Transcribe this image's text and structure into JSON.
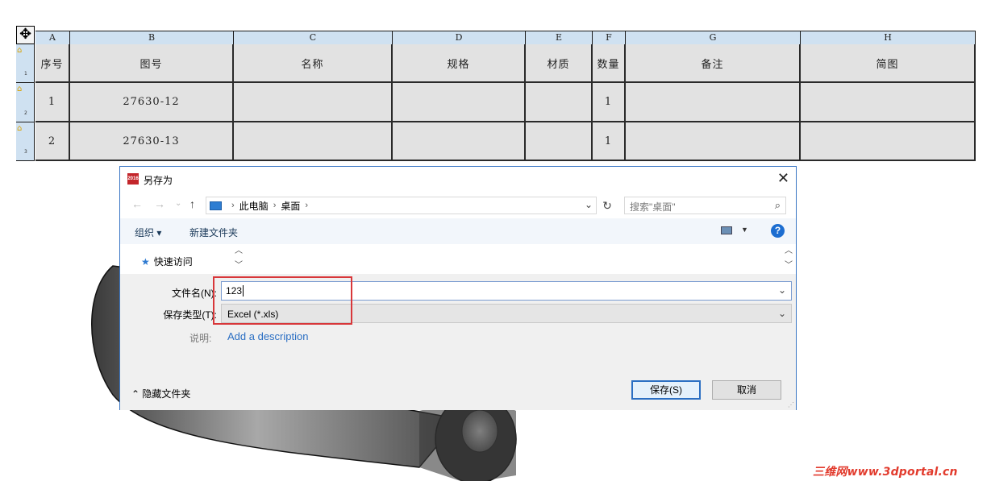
{
  "table": {
    "columns": [
      "A",
      "B",
      "C",
      "D",
      "E",
      "F",
      "G",
      "H"
    ],
    "rows": [
      "1",
      "2",
      "3"
    ],
    "header": [
      "序号",
      "图号",
      "名称",
      "规格",
      "材质",
      "数量",
      "备注",
      "简图"
    ],
    "data": [
      [
        "1",
        "27630-12",
        "",
        "",
        "",
        "1",
        "",
        ""
      ],
      [
        "2",
        "27630-13",
        "",
        "",
        "",
        "1",
        "",
        ""
      ]
    ]
  },
  "dialog": {
    "title": "另存为",
    "app_icon_label": "2016",
    "close_icon": "close-icon",
    "nav": {
      "back_icon": "←",
      "forward_icon": "→",
      "recent_icon": "⌄",
      "up_icon": "↑",
      "path": [
        "此电脑",
        "桌面"
      ],
      "search_placeholder": "搜索\"桌面\""
    },
    "toolbar": {
      "organize": "组织 ▾",
      "new_folder": "新建文件夹"
    },
    "nav_pane": {
      "quick_access": "快速访问"
    },
    "form": {
      "filename_label": "文件名(N):",
      "filename_value": "123",
      "filetype_label": "保存类型(T):",
      "filetype_value": "Excel (*.xls)",
      "description_label": "说明:",
      "description_link": "Add a description"
    },
    "footer": {
      "hide_folders": "隐藏文件夹",
      "save": "保存(S)",
      "cancel": "取消"
    }
  },
  "watermark": "三维网www.3dportal.cn",
  "colors": {
    "accent": "#2b6fc3",
    "highlight_box": "#d8373a",
    "header_blue": "#cfe1f1",
    "cell_gray": "#e2e2e2"
  }
}
